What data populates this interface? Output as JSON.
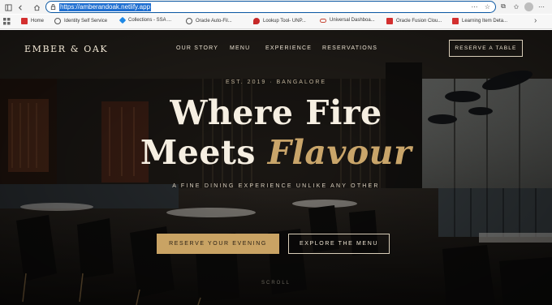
{
  "browser": {
    "url": "https://amberandoak.netlify.app",
    "bookmarks": [
      {
        "label": "Home",
        "icon": "red-app-icon"
      },
      {
        "label": "Identity Self Service",
        "icon": "globe-icon"
      },
      {
        "label": "Collections - SSA ...",
        "icon": "blue-x-icon"
      },
      {
        "label": "Oracle Auto-Fil...",
        "icon": "globe-icon"
      },
      {
        "label": "Lookup Tool- UNP...",
        "icon": "pin-icon"
      },
      {
        "label": "Universal Dashboa...",
        "icon": "oracle-icon"
      },
      {
        "label": "Oracle Fusion Clou...",
        "icon": "red-app-icon"
      },
      {
        "label": "Learning Item Deta...",
        "icon": "red-app-icon"
      }
    ]
  },
  "site": {
    "brand": "EMBER & OAK",
    "nav": [
      "OUR STORY",
      "MENU",
      "EXPERIENCE",
      "RESERVATIONS"
    ],
    "reserve_table": "RESERVE A TABLE"
  },
  "hero": {
    "eyebrow": "EST. 2019 · BANGALORE",
    "headline_line1": "Where Fire",
    "headline_line2_plain": "Meets ",
    "headline_line2_accent": "Flavour",
    "tagline": "A FINE DINING EXPERIENCE UNLIKE ANY OTHER",
    "primary_cta": "RESERVE YOUR EVENING",
    "secondary_cta": "EXPLORE THE MENU",
    "scroll_hint": "SCROLL"
  },
  "colors": {
    "accent_gold": "#c9a364",
    "headline": "#f6efe2",
    "address_highlight": "#1f6fd1"
  }
}
